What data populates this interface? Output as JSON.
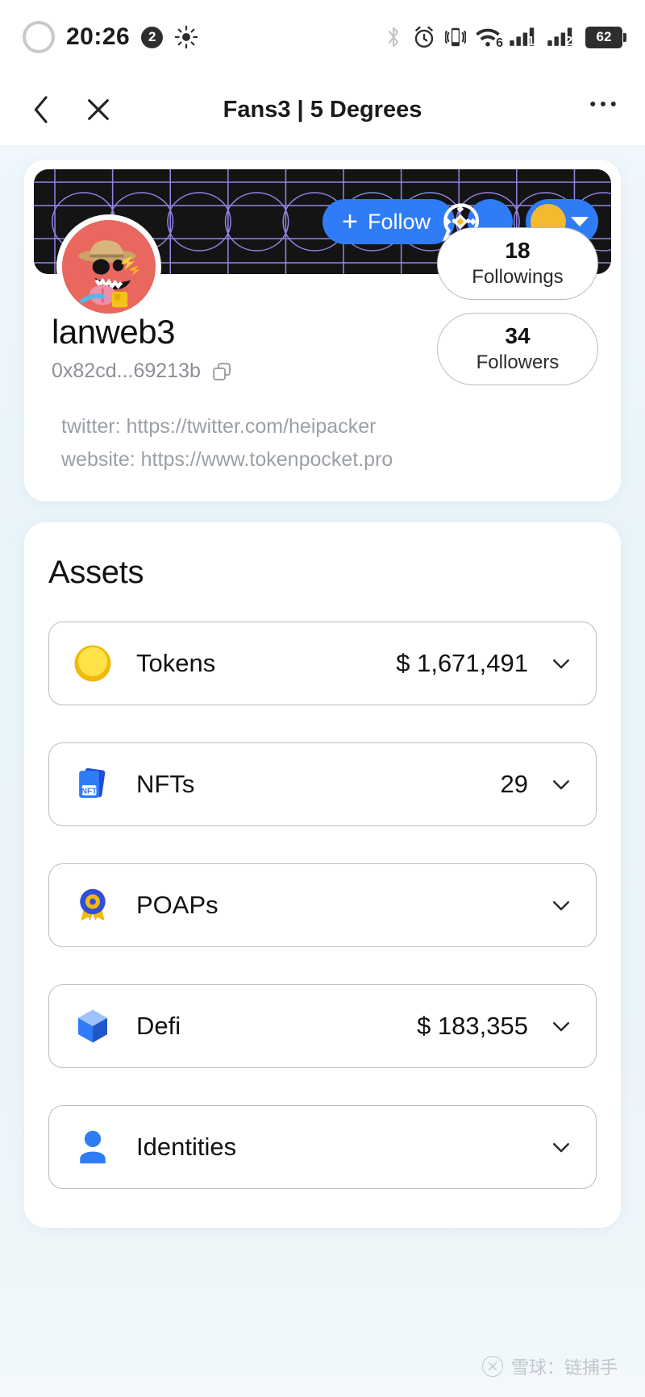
{
  "status_bar": {
    "time": "20:26",
    "notification_count": "2",
    "battery_level": "62",
    "signal_1_label": "1",
    "signal_2_label": "2",
    "wifi_label": "6",
    "icons": [
      "record-ring-icon",
      "brightness-icon",
      "bluetooth-icon",
      "alarm-icon",
      "vibrate-icon",
      "wifi-icon",
      "signal-sim1-icon",
      "signal-sim2-icon",
      "battery-icon"
    ]
  },
  "nav": {
    "title": "Fans3 | 5 Degrees",
    "back_icon": "chevron-left-icon",
    "close_icon": "close-icon",
    "more_icon": "more-horizontal-icon"
  },
  "profile": {
    "username": "lanweb3",
    "address": "0x82cd...69213b",
    "copy_icon": "copy-icon",
    "follow_label": "Follow",
    "message_icon": "message-bubble-icon",
    "chain_icon": "bnb-chain-icon",
    "chain_caret_icon": "caret-down-icon",
    "links": [
      "twitter: https://twitter.com/heipacker",
      "website: https://www.tokenpocket.pro"
    ],
    "stats": [
      {
        "value": "18",
        "label": "Followings"
      },
      {
        "value": "34",
        "label": "Followers"
      }
    ]
  },
  "assets": {
    "title": "Assets",
    "rows": [
      {
        "icon": "gold-coin-icon",
        "label": "Tokens",
        "value": "$ 1,671,491",
        "chevron": "chevron-down-icon"
      },
      {
        "icon": "nft-cards-icon",
        "label": "NFTs",
        "value": "29",
        "chevron": "chevron-down-icon"
      },
      {
        "icon": "poap-badge-icon",
        "label": "POAPs",
        "value": "",
        "chevron": "chevron-down-icon"
      },
      {
        "icon": "defi-cube-icon",
        "label": "Defi",
        "value": "$ 183,355",
        "chevron": "chevron-down-icon"
      },
      {
        "icon": "person-icon",
        "label": "Identities",
        "value": "",
        "chevron": "chevron-down-icon"
      }
    ]
  },
  "watermark": {
    "text": "雪球：链捕手",
    "logo_icon": "xueqiu-logo-icon"
  },
  "colors": {
    "accent_blue": "#2f7cf6",
    "bnb_yellow": "#F3BA2F",
    "banner_dark": "#141414",
    "banner_grid": "#8b7df0"
  }
}
